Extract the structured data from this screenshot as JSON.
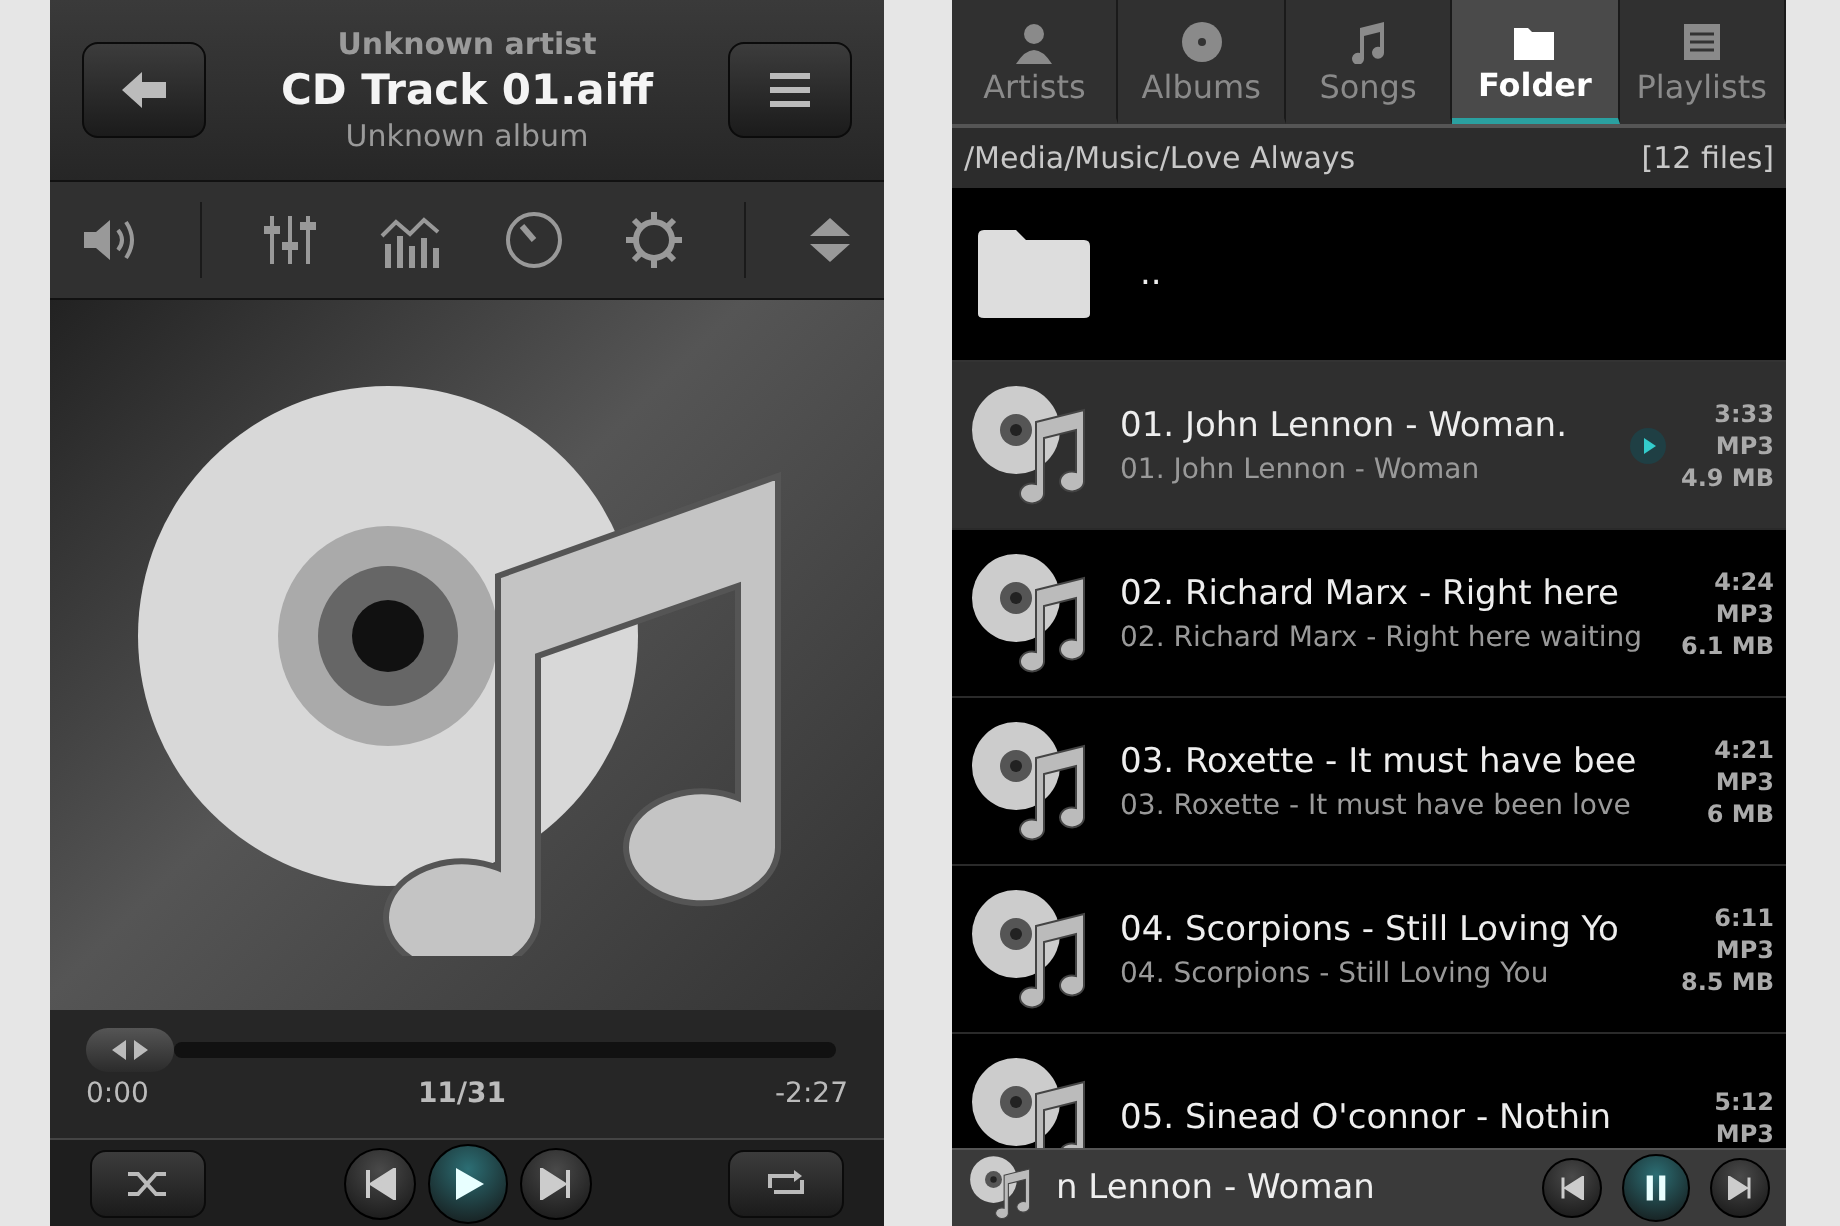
{
  "player": {
    "artist": "Unknown artist",
    "title": "CD Track 01.aiff",
    "album": "Unknown album",
    "progress": {
      "level": 0,
      "elapsed": "0:00",
      "position": "11/31",
      "remaining": "-2:27"
    },
    "shuffle": false,
    "repeat": false,
    "playing": false
  },
  "library": {
    "tabs": [
      {
        "label": "Artists",
        "kind": "person",
        "selected": false
      },
      {
        "label": "Albums",
        "kind": "disc",
        "selected": false
      },
      {
        "label": "Songs",
        "kind": "note",
        "selected": false
      },
      {
        "label": "Folder",
        "kind": "folder",
        "selected": true
      },
      {
        "label": "Playlists",
        "kind": "list",
        "selected": false
      }
    ],
    "path": "/Media/Music/Love Always",
    "count": "[12 files]",
    "parent": "..",
    "files": [
      {
        "title": "01. John Lennon - Woman.",
        "subtitle": "01. John Lennon - Woman",
        "duration": "3:33",
        "format": "MP3",
        "size": "4.9 MB",
        "playing": true
      },
      {
        "title": "02. Richard Marx - Right here",
        "subtitle": "02. Richard Marx - Right here waiting",
        "duration": "4:24",
        "format": "MP3",
        "size": "6.1 MB",
        "playing": false
      },
      {
        "title": "03. Roxette - It must have bee",
        "subtitle": "03. Roxette - It must have been love",
        "duration": "4:21",
        "format": "MP3",
        "size": "6 MB",
        "playing": false
      },
      {
        "title": "04. Scorpions - Still Loving Yo",
        "subtitle": "04. Scorpions - Still Loving You",
        "duration": "6:11",
        "format": "MP3",
        "size": "8.5 MB",
        "playing": false
      },
      {
        "title": "05. Sinead O'connor - Nothin",
        "duration": "5:12",
        "format": "MP3",
        "playing": false
      }
    ],
    "mini_player": {
      "title": "n Lennon - Woman",
      "playing": true
    }
  }
}
